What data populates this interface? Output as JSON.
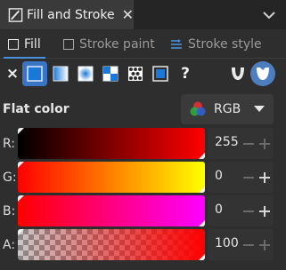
{
  "dock": {
    "tab_title": "Fill and Stroke",
    "close_glyph": "✕"
  },
  "subtabs": [
    {
      "label": "Fill",
      "active": true
    },
    {
      "label": "Stroke paint",
      "active": false
    },
    {
      "label": "Stroke style",
      "active": false
    }
  ],
  "paint_types": {
    "none_glyph": "×",
    "unset_glyph": "?",
    "items": [
      "no-paint",
      "flat-color",
      "linear-gradient",
      "radial-gradient",
      "mesh-gradient",
      "pattern",
      "swatch",
      "unset"
    ],
    "active": "flat-color",
    "fill_rules": [
      "evenodd",
      "nonzero"
    ],
    "active_rule": "nonzero"
  },
  "color": {
    "flat_label": "Flat color",
    "mode": "RGB",
    "channels": [
      {
        "label": "R:",
        "value": "255"
      },
      {
        "label": "G:",
        "value": "0"
      },
      {
        "label": "B:",
        "value": "0"
      },
      {
        "label": "A:",
        "value": "100"
      }
    ],
    "accent": "#3a74c4",
    "current": "#ff0000"
  }
}
